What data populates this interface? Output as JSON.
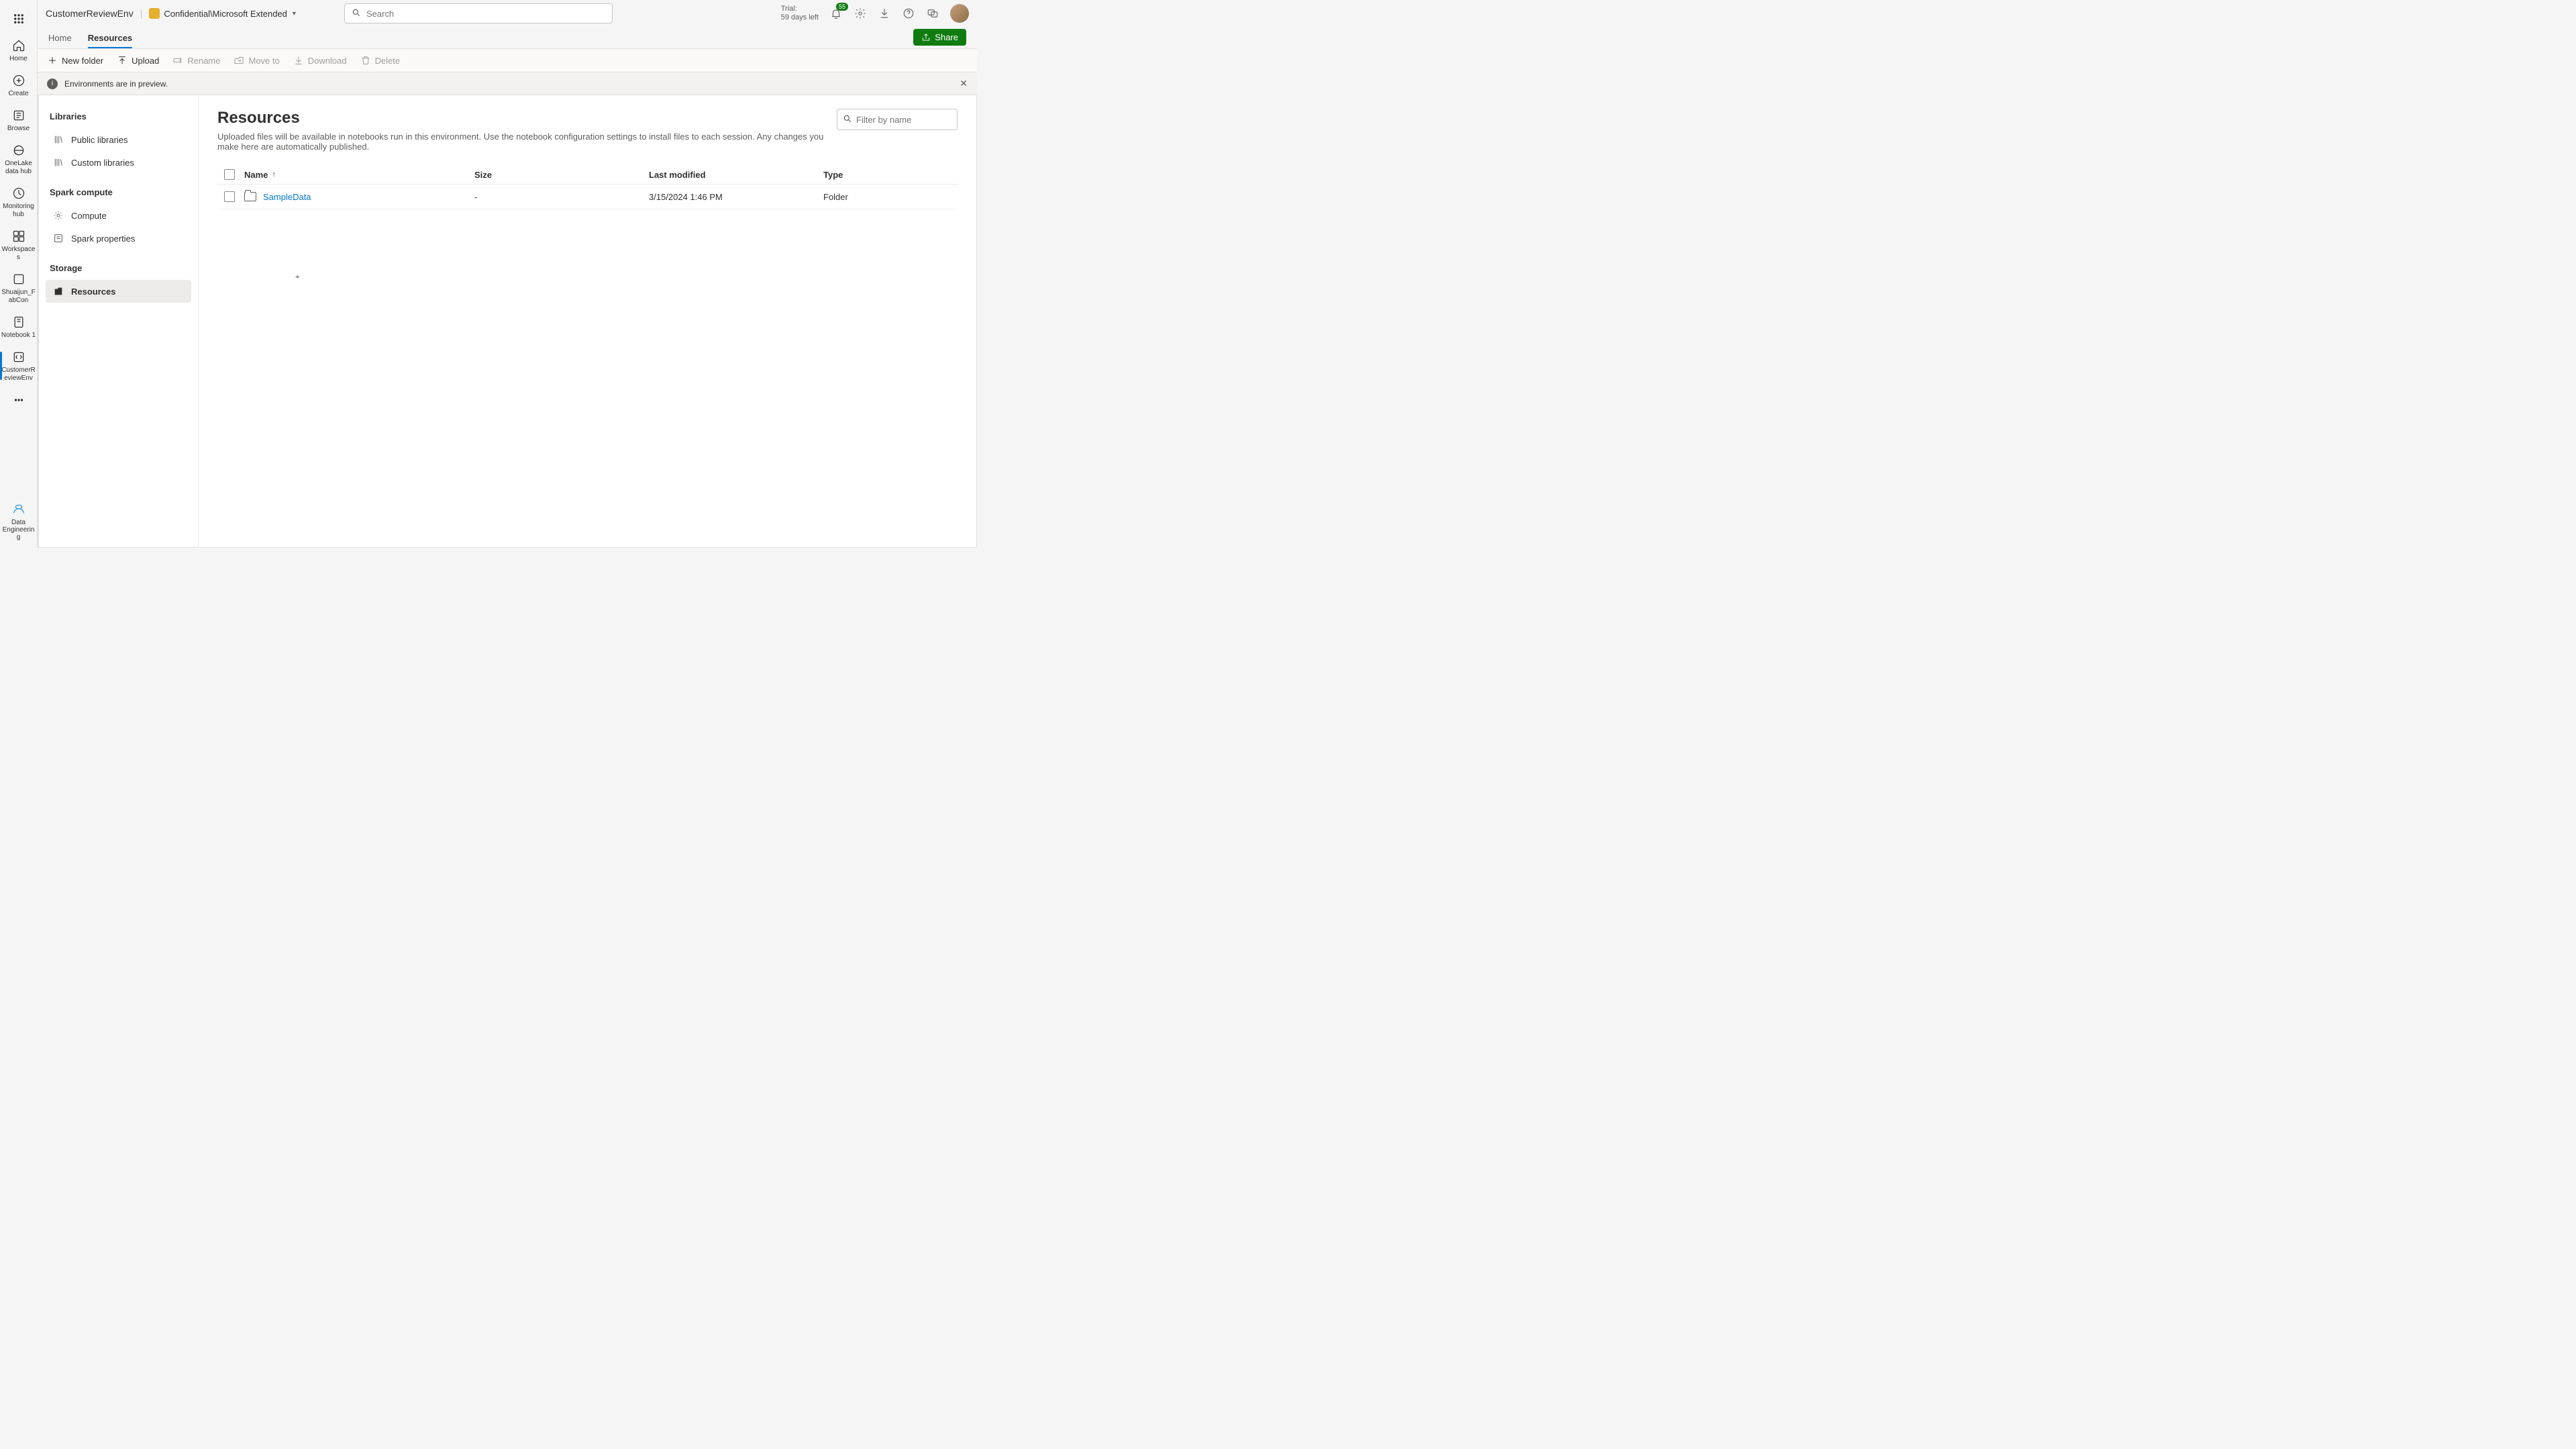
{
  "topbar": {
    "breadcrumb_title": "CustomerReviewEnv",
    "sensitivity_label": "Confidential\\Microsoft Extended",
    "search_placeholder": "Search",
    "trial_line1": "Trial:",
    "trial_line2": "59 days left",
    "notif_count": "55",
    "share_label": "Share"
  },
  "rail": {
    "items": [
      {
        "label": "Home",
        "icon": "home-icon"
      },
      {
        "label": "Create",
        "icon": "plus-icon"
      },
      {
        "label": "Browse",
        "icon": "browse-icon"
      },
      {
        "label": "OneLake data hub",
        "icon": "onelake-icon"
      },
      {
        "label": "Monitoring hub",
        "icon": "monitor-icon"
      },
      {
        "label": "Workspaces",
        "icon": "workspaces-icon"
      },
      {
        "label": "Shuaijun_FabCon",
        "icon": "workspace-item-icon"
      },
      {
        "label": "Notebook 1",
        "icon": "notebook-icon"
      },
      {
        "label": "CustomerReviewEnv",
        "icon": "env-icon"
      }
    ],
    "bottom_label": "Data Engineering"
  },
  "tabs": [
    {
      "label": "Home",
      "active": false
    },
    {
      "label": "Resources",
      "active": true
    }
  ],
  "toolbar": {
    "new_folder": "New folder",
    "upload": "Upload",
    "rename": "Rename",
    "move_to": "Move to",
    "download": "Download",
    "delete": "Delete"
  },
  "banner": {
    "text": "Environments are in preview."
  },
  "sidebar": {
    "groups": [
      {
        "title": "Libraries",
        "items": [
          {
            "label": "Public libraries",
            "icon": "lib-icon"
          },
          {
            "label": "Custom libraries",
            "icon": "lib-icon"
          }
        ]
      },
      {
        "title": "Spark compute",
        "items": [
          {
            "label": "Compute",
            "icon": "gear-icon"
          },
          {
            "label": "Spark properties",
            "icon": "props-icon"
          }
        ]
      },
      {
        "title": "Storage",
        "items": [
          {
            "label": "Resources",
            "icon": "res-icon",
            "active": true
          }
        ]
      }
    ]
  },
  "page": {
    "title": "Resources",
    "description": "Uploaded files will be available in notebooks run in this environment. Use the notebook configuration settings to install files to each session. Any changes you make here are automatically published.",
    "filter_placeholder": "Filter by name",
    "columns": {
      "name": "Name",
      "size": "Size",
      "modified": "Last modified",
      "type": "Type"
    },
    "rows": [
      {
        "name": "SampleData",
        "size": "-",
        "modified": "3/15/2024 1:46 PM",
        "type": "Folder"
      }
    ]
  }
}
